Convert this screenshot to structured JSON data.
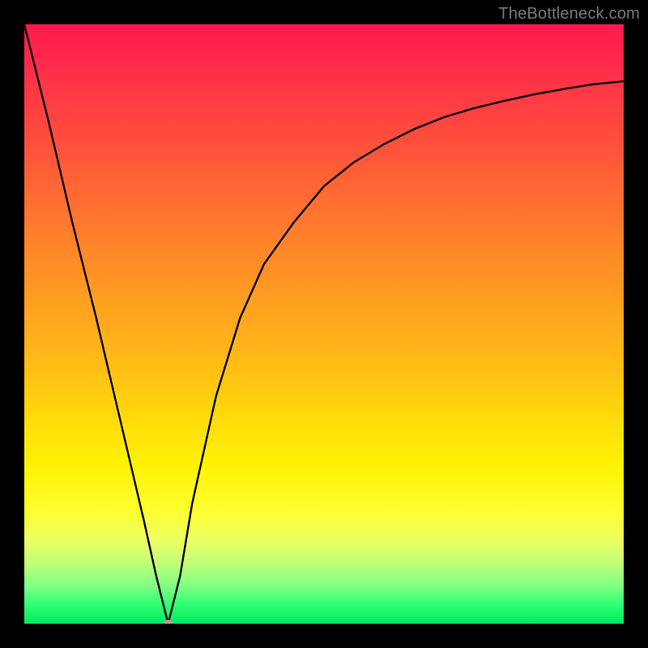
{
  "watermark": "TheBottleneck.com",
  "chart_data": {
    "type": "line",
    "note": "Bottleneck percentage curve. Background color encodes bottleneck severity (red=high at top, green=low at bottom). The black curve shows bottleneck % as a function of the x-axis variable; it drops to ~0% around x≈0.24 (the optimal point, marked by a small pink dot) and rises steeply on the left and more gradually on the right.",
    "xlim": [
      0,
      1
    ],
    "ylim": [
      0,
      100
    ],
    "xlabel": "",
    "ylabel": "",
    "title": "",
    "optimal_point": {
      "x": 0.24,
      "y": 0
    },
    "series": [
      {
        "name": "bottleneck-curve",
        "x": [
          0.0,
          0.04,
          0.08,
          0.12,
          0.16,
          0.2,
          0.22,
          0.24,
          0.26,
          0.28,
          0.32,
          0.36,
          0.4,
          0.45,
          0.5,
          0.55,
          0.6,
          0.65,
          0.7,
          0.75,
          0.8,
          0.85,
          0.9,
          0.95,
          1.0
        ],
        "y": [
          100,
          84,
          67,
          51,
          34,
          17,
          8,
          0,
          8,
          20,
          38,
          51,
          60,
          67,
          73,
          77,
          80,
          82.5,
          84.5,
          86,
          87.2,
          88.3,
          89.2,
          90,
          90.5
        ]
      }
    ],
    "marker": {
      "x": 0.24,
      "y": 0,
      "color": "#e08a8a"
    }
  }
}
